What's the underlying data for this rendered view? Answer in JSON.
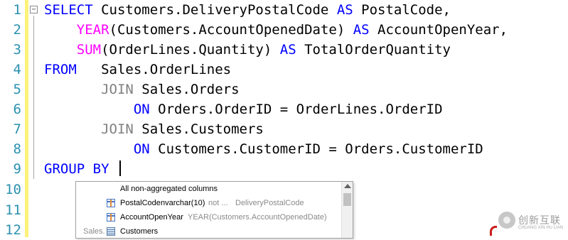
{
  "editor": {
    "line_numbers": [
      "1",
      "2",
      "3",
      "4",
      "5",
      "6",
      "7",
      "8",
      "9",
      "10",
      "11",
      "12"
    ],
    "lines": [
      [
        {
          "t": "SELECT",
          "c": "kw"
        },
        {
          "t": " Customers.DeliveryPostalCode ",
          "c": ""
        },
        {
          "t": "AS",
          "c": "kw"
        },
        {
          "t": " PostalCode,",
          "c": ""
        }
      ],
      [
        {
          "t": "    ",
          "c": ""
        },
        {
          "t": "YEAR",
          "c": "fn"
        },
        {
          "t": "(Customers.AccountOpenedDate) ",
          "c": ""
        },
        {
          "t": "AS",
          "c": "kw"
        },
        {
          "t": " AccountOpenYear,",
          "c": ""
        }
      ],
      [
        {
          "t": "    ",
          "c": ""
        },
        {
          "t": "SUM",
          "c": "fn"
        },
        {
          "t": "(OrderLines.Quantity) ",
          "c": ""
        },
        {
          "t": "AS",
          "c": "kw"
        },
        {
          "t": " TotalOrderQuantity",
          "c": ""
        }
      ],
      [
        {
          "t": "FROM",
          "c": "kw"
        },
        {
          "t": "   Sales.OrderLines",
          "c": ""
        }
      ],
      [
        {
          "t": "       ",
          "c": ""
        },
        {
          "t": "JOIN",
          "c": "gy"
        },
        {
          "t": " Sales.Orders",
          "c": ""
        }
      ],
      [
        {
          "t": "           ",
          "c": ""
        },
        {
          "t": "ON",
          "c": "kw"
        },
        {
          "t": " Orders.OrderID = OrderLines.OrderID",
          "c": ""
        }
      ],
      [
        {
          "t": "       ",
          "c": ""
        },
        {
          "t": "JOIN",
          "c": "gy"
        },
        {
          "t": " Sales.Customers",
          "c": ""
        }
      ],
      [
        {
          "t": "           ",
          "c": ""
        },
        {
          "t": "ON",
          "c": "kw"
        },
        {
          "t": " Customers.CustomerID = Orders.CustomerID",
          "c": ""
        }
      ],
      [
        {
          "t": "GROUP BY",
          "c": "kw"
        },
        {
          "t": " ",
          "c": ""
        }
      ]
    ],
    "colors": {
      "keyword": "#0000ff",
      "function": "#ff00ff",
      "join": "#808080",
      "line_number": "#2b91af",
      "change_bar": "#fdf27a"
    }
  },
  "intellisense": {
    "items": [
      {
        "icon": "none",
        "name": "All non-aggregated columns",
        "type": "",
        "detail": ""
      },
      {
        "icon": "column",
        "name": "PostalCode",
        "type": "nvarchar(10)",
        "extra": "not ...",
        "detail": "DeliveryPostalCode"
      },
      {
        "icon": "column",
        "name": "AccountOpenYear",
        "type": "",
        "detail": "YEAR(Customers.AccountOpenedDate)"
      },
      {
        "icon": "table",
        "name": "Customers",
        "prefix": "Sales.",
        "type": "",
        "detail": ""
      }
    ]
  },
  "watermark": {
    "text": "创新互联",
    "subtext": "CHUANG XIN HU LIAN"
  }
}
